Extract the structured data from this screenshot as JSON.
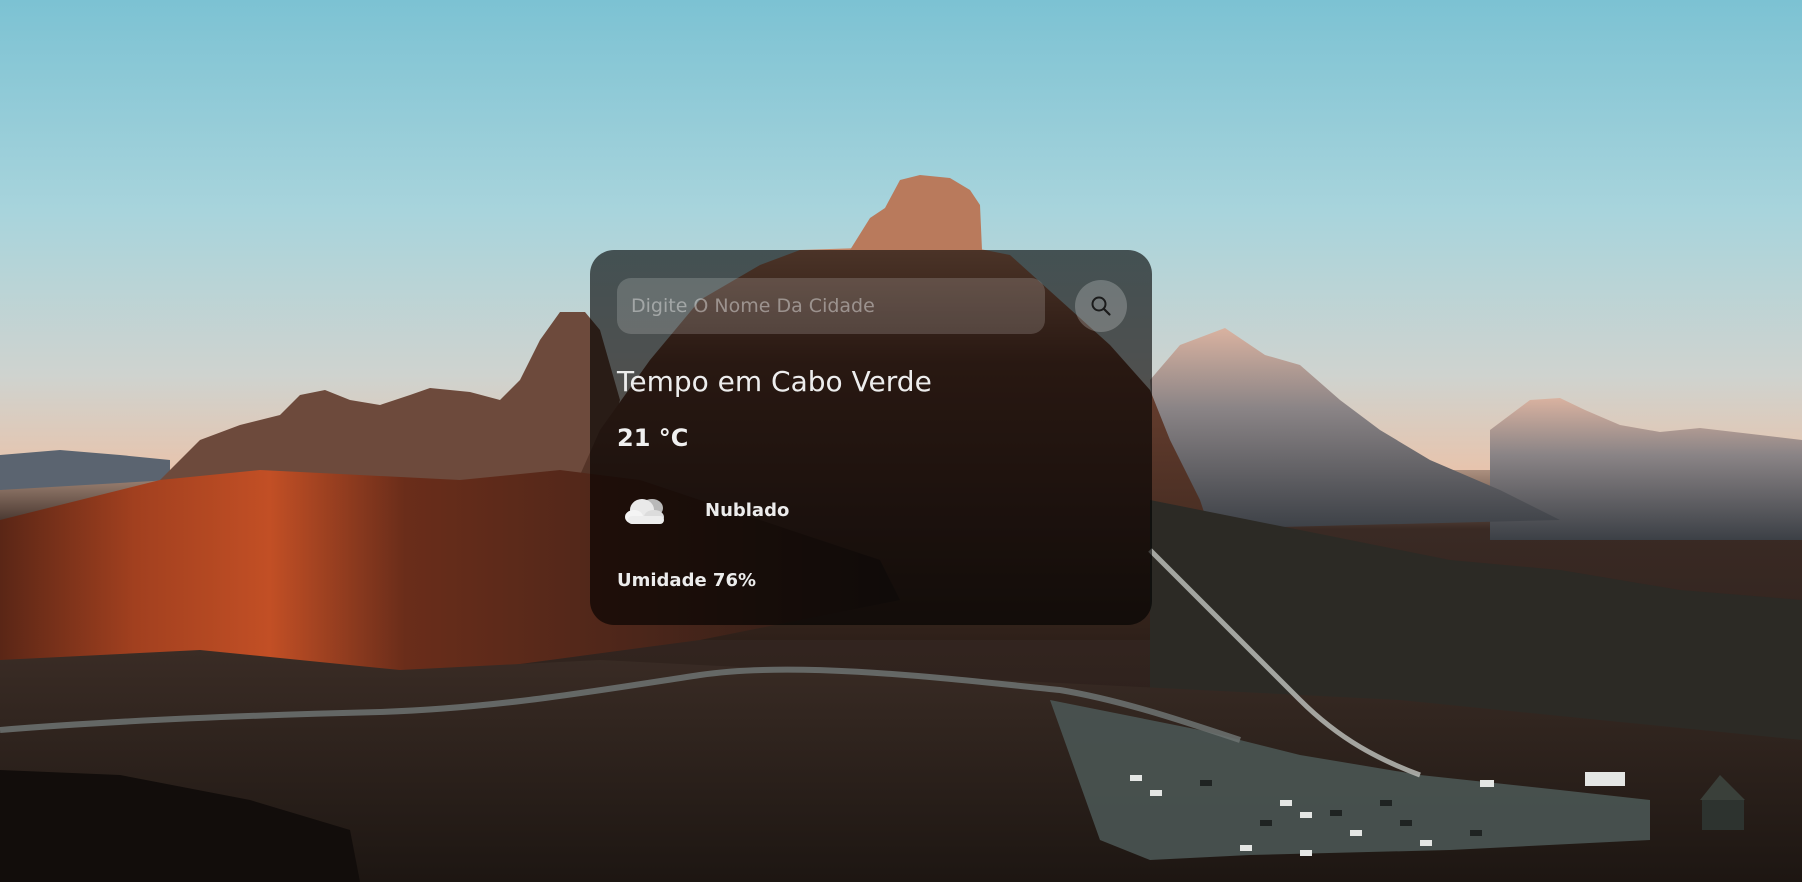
{
  "search": {
    "placeholder": "Digite O Nome Da Cidade",
    "value": "",
    "button_icon": "search-icon"
  },
  "weather": {
    "title": "Tempo em Cabo Verde",
    "temperature": "21 °C",
    "condition_icon": "cloud-icon",
    "description": "Nublado",
    "humidity": "Umidade 76%"
  },
  "colors": {
    "card_background": "#000000",
    "card_opacity": 0.62,
    "text": "#ececec",
    "sky_top": "#7fc4d4",
    "horizon": "#e3c1ab"
  }
}
